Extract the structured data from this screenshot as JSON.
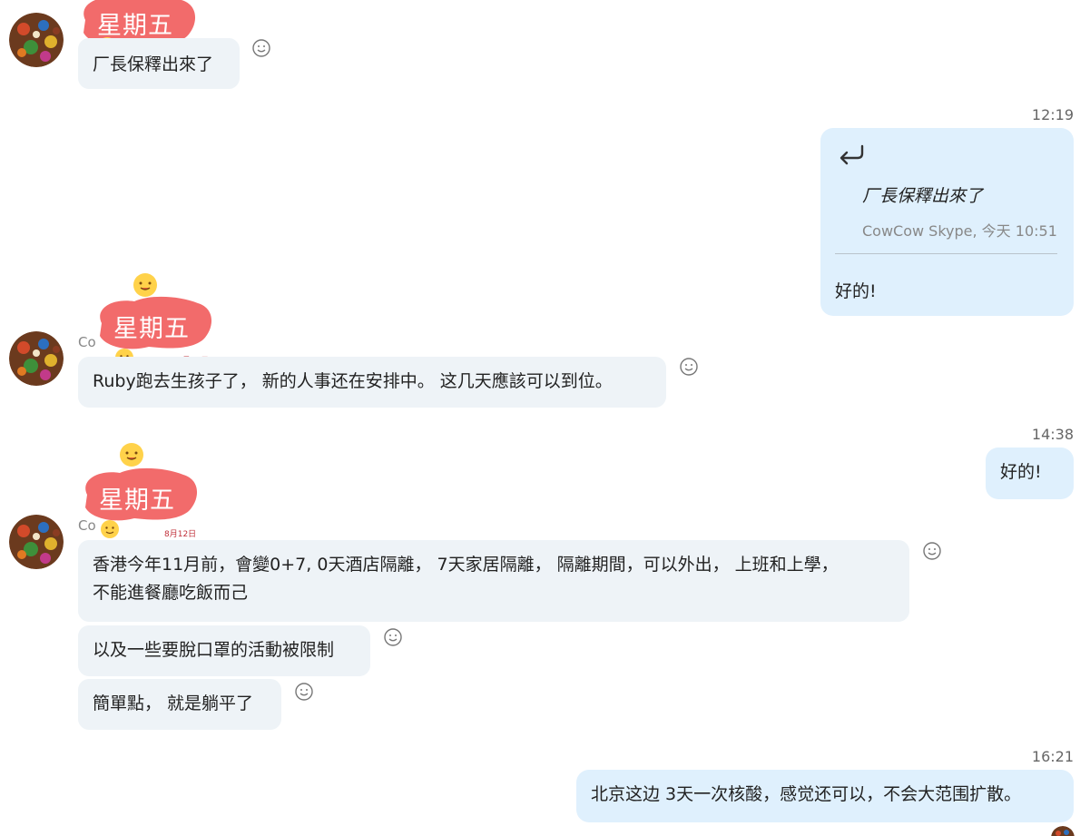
{
  "messages": {
    "m1": {
      "text": "厂長保釋出來了"
    },
    "m2": {
      "time": "12:19",
      "quote_text": "厂長保釋出來了",
      "quote_meta": "CowCow Skype, 今天 10:51",
      "text": "好的!"
    },
    "m3": {
      "sender_fragment": "Co",
      "text": "Ruby跑去生孩子了， 新的人事还在安排中。 这几天應該可以到位。"
    },
    "m4": {
      "time": "14:38",
      "text": "好的!"
    },
    "m5": {
      "sender_fragment": "Co",
      "line1": "香港今年11月前，會變0+7, 0天酒店隔離， 7天家居隔離， 隔離期間，可以外出， 上班和上學，",
      "line2": "不能進餐廳吃飯而己"
    },
    "m6": {
      "text": "以及一些要脫口罩的活動被限制"
    },
    "m7": {
      "text": "簡單點， 就是躺平了"
    },
    "m8": {
      "time": "16:21",
      "text": "北京这边 3天一次核酸，感觉还可以，不会大范围扩散。"
    }
  },
  "sticker": {
    "title": "星期五",
    "date": "8月12日"
  },
  "colors": {
    "incoming_bubble": "#eef3f7",
    "outgoing_bubble": "#dff0fd",
    "sticker_pink": "#f26b6b",
    "timestamp": "#666666"
  },
  "icons": {
    "reaction": "smiley-icon",
    "reply": "reply-arrow-icon",
    "avatar": "avatar"
  }
}
